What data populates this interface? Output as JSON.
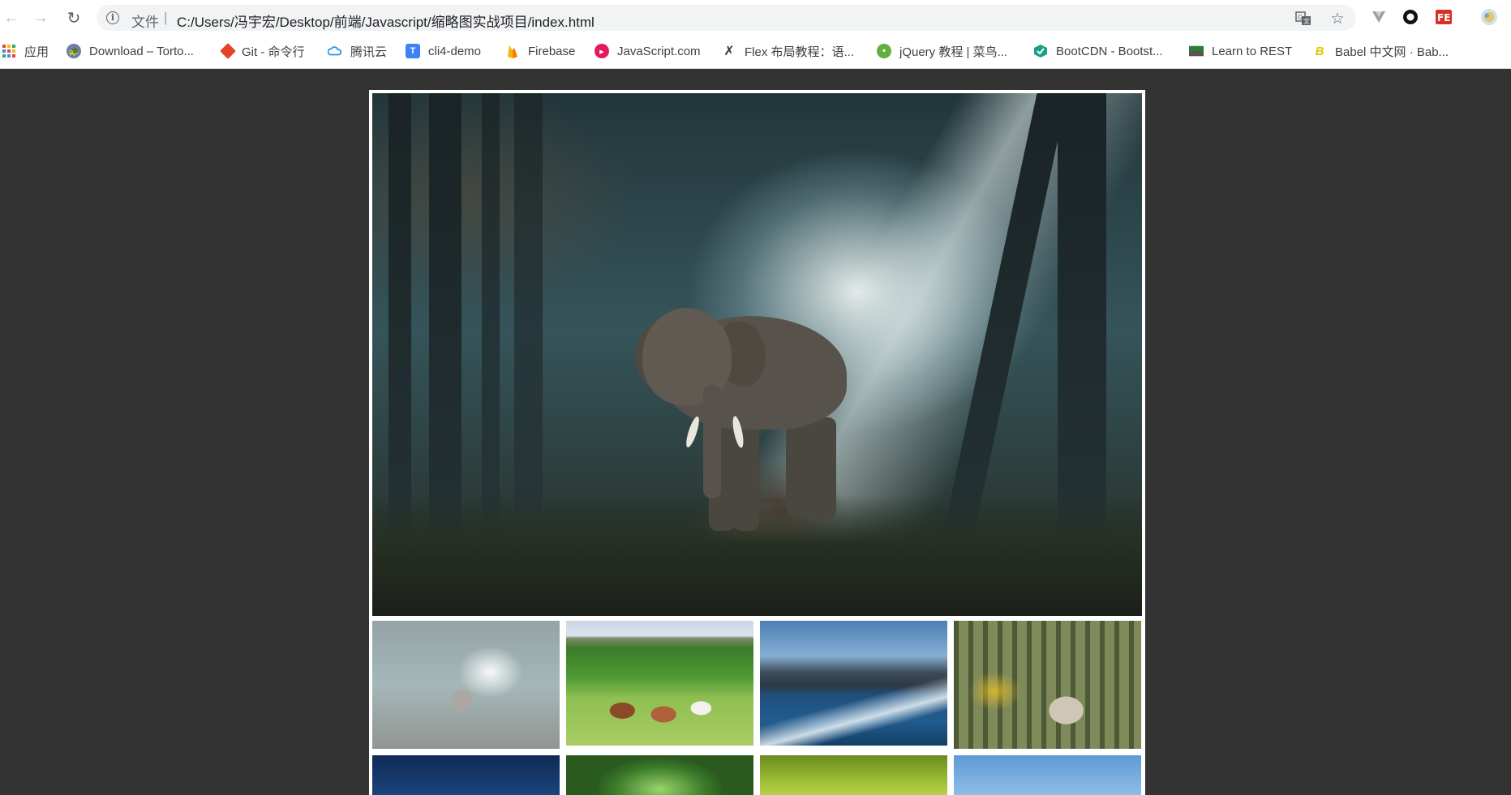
{
  "browser": {
    "nav": {
      "back_icon": "arrow-left-icon",
      "forward_icon": "arrow-right-icon",
      "reload_icon": "reload-icon"
    },
    "address": {
      "security_label": "文件",
      "separator": "|",
      "url": "C:/Users/冯宇宏/Desktop/前端/Javascript/缩略图实战项目/index.html"
    },
    "toolbar_icons": [
      "translate-icon",
      "star-icon"
    ],
    "extensions": [
      "vue-devtools-icon",
      "record-icon",
      "fe-helper-icon",
      "profile-avatar-icon"
    ]
  },
  "bookmarks": [
    {
      "label": "应用",
      "icon": "apps-grid-icon",
      "color": "#ea4335"
    },
    {
      "label": "Download – Torto...",
      "icon": "tortoise-icon",
      "color": "#6b7fa6"
    },
    {
      "label": "Git - 命令行",
      "icon": "git-icon",
      "color": "#e24329"
    },
    {
      "label": "腾讯云",
      "icon": "cloud-icon",
      "color": "#2e8ded"
    },
    {
      "label": "cli4-demo",
      "icon": "t-logo-icon",
      "color": "#3b82f6"
    },
    {
      "label": "Firebase",
      "icon": "firebase-icon",
      "color": "#f6b50e"
    },
    {
      "label": "JavaScript.com",
      "icon": "javascript-com-icon",
      "color": "#e6195d"
    },
    {
      "label": "Flex 布局教程：语...",
      "icon": "ruanyifeng-icon",
      "color": "#333333"
    },
    {
      "label": "jQuery 教程 | 菜鸟...",
      "icon": "runoob-icon",
      "color": "#5fb041"
    },
    {
      "label": "BootCDN - Bootst...",
      "icon": "bootcdn-icon",
      "color": "#1aa184"
    },
    {
      "label": "Learn to REST",
      "icon": "rest-flag-icon",
      "color": "#2e7d32"
    },
    {
      "label": "Babel 中文网 · Bab...",
      "icon": "babel-icon",
      "color": "#e6c400"
    }
  ],
  "gallery": {
    "main_image": "elephant-in-forest",
    "thumbnails": [
      {
        "subject": "elephant-in-forest",
        "active": true
      },
      {
        "subject": "cows-in-meadow",
        "active": false
      },
      {
        "subject": "surfer-on-wave",
        "active": false
      },
      {
        "subject": "man-with-reindeer",
        "active": false
      },
      {
        "subject": "night-sky-thumbnail",
        "active": false
      },
      {
        "subject": "green-bokeh-thumbnail",
        "active": false
      },
      {
        "subject": "grass-thumbnail",
        "active": false
      },
      {
        "subject": "blue-sky-thumbnail",
        "active": false
      }
    ]
  }
}
